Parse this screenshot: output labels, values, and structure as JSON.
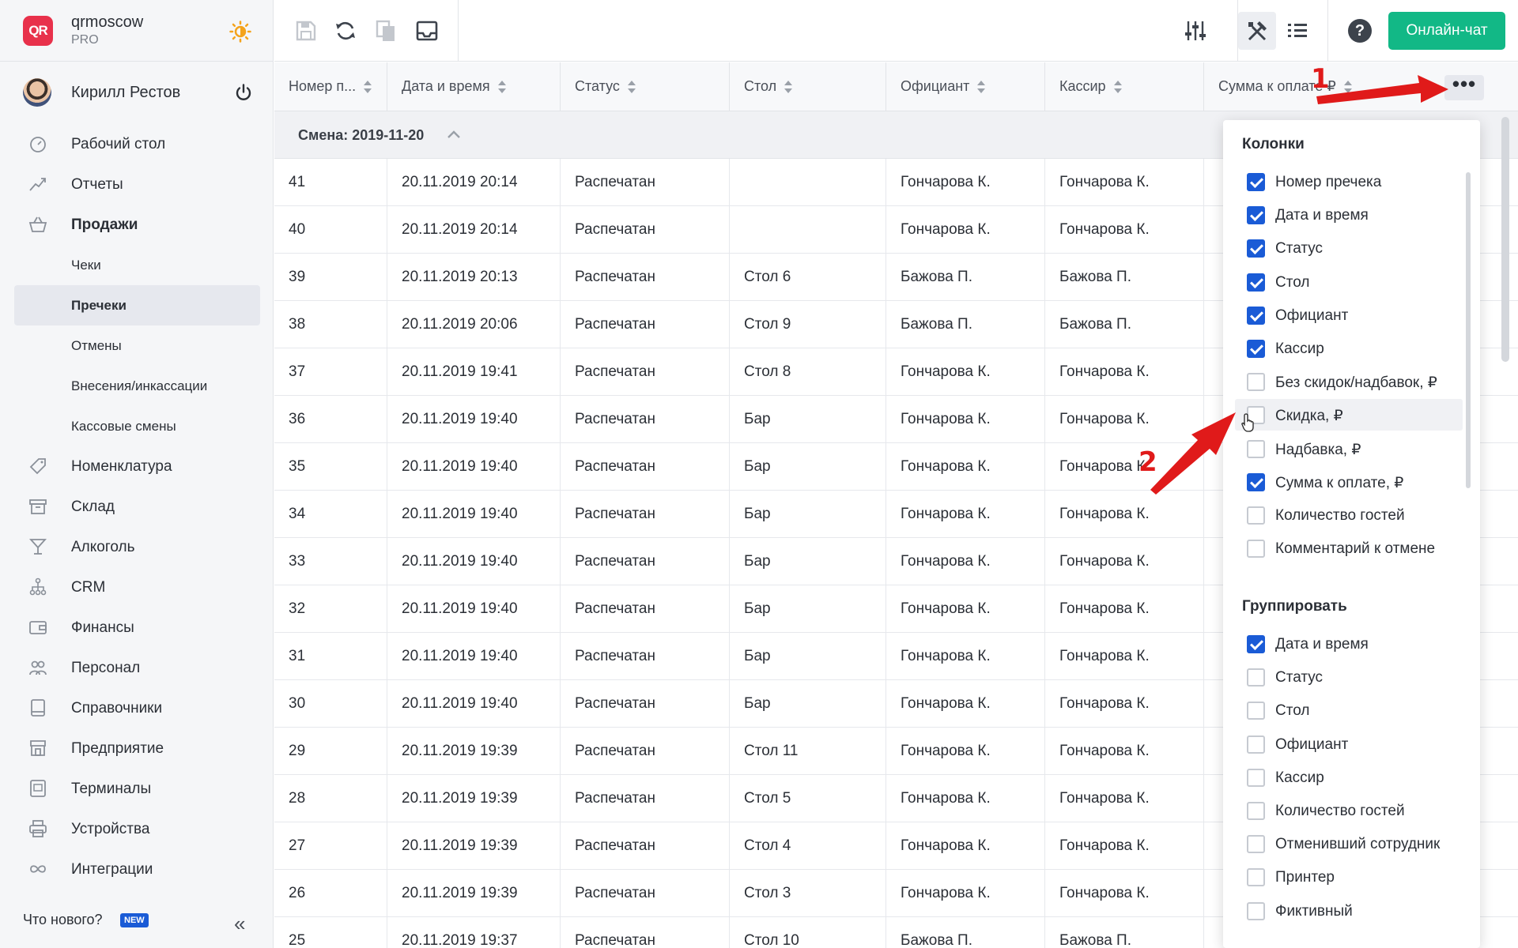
{
  "brand": {
    "name": "qrmoscow",
    "plan": "PRO",
    "logo_text": "QR"
  },
  "user": {
    "name": "Кирилл Рестов"
  },
  "nav": {
    "items": [
      {
        "label": "Рабочий стол",
        "icon": "dashboard-icon"
      },
      {
        "label": "Отчеты",
        "icon": "chart-icon"
      },
      {
        "label": "Продажи",
        "icon": "basket-icon"
      }
    ],
    "sub": [
      {
        "label": "Чеки"
      },
      {
        "label": "Пречеки"
      },
      {
        "label": "Отмены"
      },
      {
        "label": "Внесения/инкассации"
      },
      {
        "label": "Кассовые смены"
      }
    ],
    "items2": [
      {
        "label": "Номенклатура",
        "icon": "tag-icon"
      },
      {
        "label": "Склад",
        "icon": "box-icon"
      },
      {
        "label": "Алкоголь",
        "icon": "cocktail-icon"
      },
      {
        "label": "CRM",
        "icon": "hierarchy-icon"
      },
      {
        "label": "Финансы",
        "icon": "wallet-icon"
      },
      {
        "label": "Персонал",
        "icon": "people-icon"
      },
      {
        "label": "Справочники",
        "icon": "book-icon"
      },
      {
        "label": "Предприятие",
        "icon": "store-icon"
      },
      {
        "label": "Терминалы",
        "icon": "terminal-icon"
      },
      {
        "label": "Устройства",
        "icon": "printer-icon"
      },
      {
        "label": "Интеграции",
        "icon": "infinity-icon"
      }
    ]
  },
  "footer": {
    "whats_new": "Что нового?",
    "new_badge": "NEW"
  },
  "toolbar": {
    "chat_label": "Онлайн-чат"
  },
  "table": {
    "headers": [
      "Номер п...",
      "Дата и время",
      "Статус",
      "Стол",
      "Официант",
      "Кассир",
      "Сумма к оплате ₽"
    ],
    "group_label": "Смена: 2019-11-20",
    "rows": [
      [
        "41",
        "20.11.2019 20:14",
        "Распечатан",
        "",
        "Гончарова К.",
        "Гончарова К."
      ],
      [
        "40",
        "20.11.2019 20:14",
        "Распечатан",
        "",
        "Гончарова К.",
        "Гончарова К."
      ],
      [
        "39",
        "20.11.2019 20:13",
        "Распечатан",
        "Стол 6",
        "Бажова П.",
        "Бажова П."
      ],
      [
        "38",
        "20.11.2019 20:06",
        "Распечатан",
        "Стол 9",
        "Бажова П.",
        "Бажова П."
      ],
      [
        "37",
        "20.11.2019 19:41",
        "Распечатан",
        "Стол 8",
        "Гончарова К.",
        "Гончарова К."
      ],
      [
        "36",
        "20.11.2019 19:40",
        "Распечатан",
        "Бар",
        "Гончарова К.",
        "Гончарова К."
      ],
      [
        "35",
        "20.11.2019 19:40",
        "Распечатан",
        "Бар",
        "Гончарова К.",
        "Гончарова К."
      ],
      [
        "34",
        "20.11.2019 19:40",
        "Распечатан",
        "Бар",
        "Гончарова К.",
        "Гончарова К."
      ],
      [
        "33",
        "20.11.2019 19:40",
        "Распечатан",
        "Бар",
        "Гончарова К.",
        "Гончарова К."
      ],
      [
        "32",
        "20.11.2019 19:40",
        "Распечатан",
        "Бар",
        "Гончарова К.",
        "Гончарова К."
      ],
      [
        "31",
        "20.11.2019 19:40",
        "Распечатан",
        "Бар",
        "Гончарова К.",
        "Гончарова К."
      ],
      [
        "30",
        "20.11.2019 19:40",
        "Распечатан",
        "Бар",
        "Гончарова К.",
        "Гончарова К."
      ],
      [
        "29",
        "20.11.2019 19:39",
        "Распечатан",
        "Стол 11",
        "Гончарова К.",
        "Гончарова К."
      ],
      [
        "28",
        "20.11.2019 19:39",
        "Распечатан",
        "Стол 5",
        "Гончарова К.",
        "Гончарова К."
      ],
      [
        "27",
        "20.11.2019 19:39",
        "Распечатан",
        "Стол 4",
        "Гончарова К.",
        "Гончарова К."
      ],
      [
        "26",
        "20.11.2019 19:39",
        "Распечатан",
        "Стол 3",
        "Гончарова К.",
        "Гончарова К."
      ],
      [
        "25",
        "20.11.2019 19:37",
        "Распечатан",
        "Стол 10",
        "Бажова П.",
        "Бажова П."
      ]
    ]
  },
  "panel": {
    "columns_title": "Колонки",
    "columns": [
      {
        "label": "Номер пречека",
        "checked": true
      },
      {
        "label": "Дата и время",
        "checked": true
      },
      {
        "label": "Статус",
        "checked": true
      },
      {
        "label": "Стол",
        "checked": true
      },
      {
        "label": "Официант",
        "checked": true
      },
      {
        "label": "Кассир",
        "checked": true
      },
      {
        "label": "Без скидок/надбавок, ₽",
        "checked": false
      },
      {
        "label": "Скидка, ₽",
        "checked": false
      },
      {
        "label": "Надбавка, ₽",
        "checked": false
      },
      {
        "label": "Сумма к оплате, ₽",
        "checked": true
      },
      {
        "label": "Количество гостей",
        "checked": false
      },
      {
        "label": "Комментарий к отмене",
        "checked": false
      }
    ],
    "group_title": "Группировать",
    "group": [
      {
        "label": "Дата и время",
        "checked": true
      },
      {
        "label": "Статус",
        "checked": false
      },
      {
        "label": "Стол",
        "checked": false
      },
      {
        "label": "Официант",
        "checked": false
      },
      {
        "label": "Кассир",
        "checked": false
      },
      {
        "label": "Количество гостей",
        "checked": false
      },
      {
        "label": "Отменивший сотрудник",
        "checked": false
      },
      {
        "label": "Принтер",
        "checked": false
      },
      {
        "label": "Фиктивный",
        "checked": false
      }
    ]
  },
  "annotations": {
    "step1": "1",
    "step2": "2",
    "color": "#e01a1a"
  },
  "colors": {
    "accent": "#1a5bd6",
    "chat": "#12b886",
    "brand": "#e8314b"
  }
}
